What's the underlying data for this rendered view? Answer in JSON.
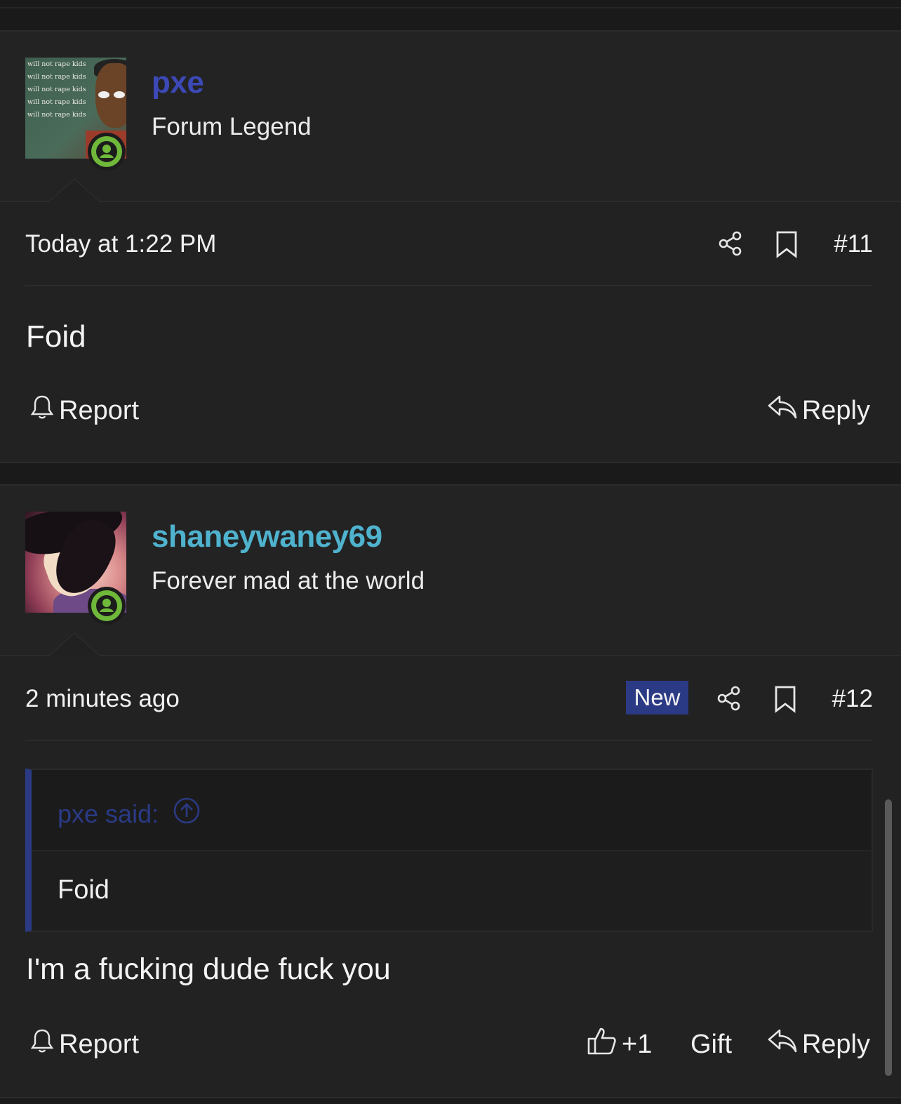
{
  "colors": {
    "background": "#1a1a1b",
    "post_background": "#222223",
    "username_1": "#3c49b6",
    "username_2": "#4fb3ce",
    "new_badge": "#2b3a84",
    "online_indicator": "#6fb83a"
  },
  "avatar_1_text": [
    "will not rape kids",
    "will not rape kids",
    "will not rape kids",
    "will not rape kids",
    "will not rape kids"
  ],
  "posts": [
    {
      "username": "pxe",
      "user_title": "Forum Legend",
      "timestamp": "Today at 1:22 PM",
      "post_number": "#11",
      "body": "Foid",
      "actions": {
        "report": "Report",
        "reply": "Reply"
      },
      "icons": [
        "user-online-icon",
        "share-icon",
        "bookmark-icon",
        "bell-icon",
        "reply-icon"
      ]
    },
    {
      "username": "shaneywaney69",
      "user_title": "Forever mad at the world",
      "timestamp": "2 minutes ago",
      "badge": "New",
      "post_number": "#12",
      "quote": {
        "author": "pxe said:",
        "text": "Foid"
      },
      "body": "I'm a fucking dude fuck you",
      "actions": {
        "report": "Report",
        "like": "+1",
        "gift": "Gift",
        "reply": "Reply"
      },
      "icons": [
        "user-online-icon",
        "share-icon",
        "bookmark-icon",
        "arrow-up-circle-icon",
        "bell-icon",
        "thumbs-up-icon",
        "reply-icon"
      ]
    }
  ]
}
